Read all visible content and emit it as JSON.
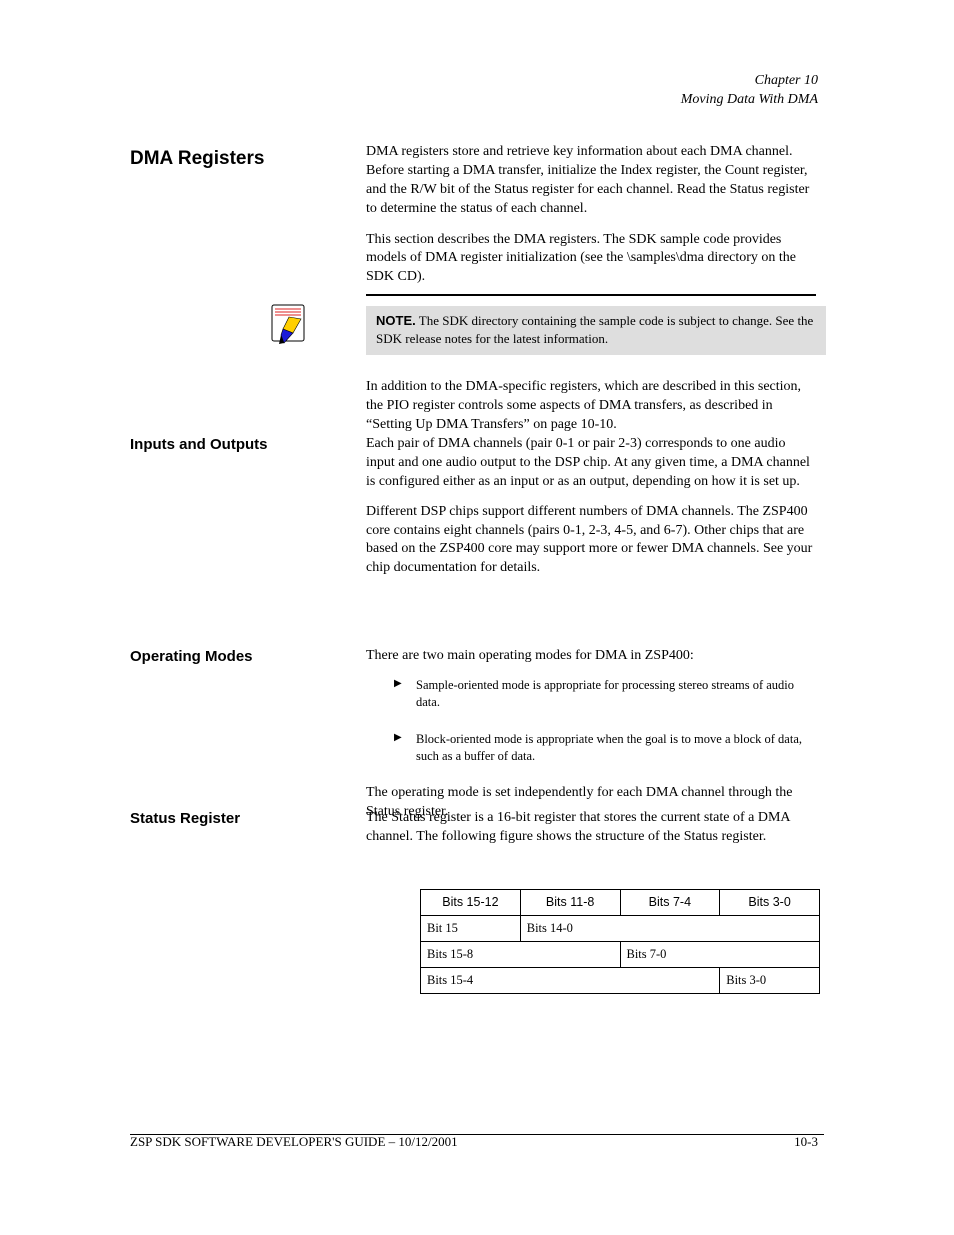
{
  "running_header": {
    "line1": "Chapter 10",
    "line2": "Moving Data With DMA"
  },
  "section_title": "DMA Registers",
  "intro": {
    "p1": "DMA registers store and retrieve key information about each DMA channel. Before starting a DMA transfer, initialize the Index register, the Count register, and the R/W bit of the Status register for each channel. Read the Status register to determine the status of each channel.",
    "p2": "This section describes the DMA registers. The SDK sample code provides models of DMA register initialization (see the \\samples\\dma directory on the SDK CD)."
  },
  "note": {
    "label": "NOTE.",
    "text": " The SDK directory containing the sample code is subject to change. See the SDK release notes for the latest information."
  },
  "after_note": "In addition to the DMA-specific registers, which are described in this section, the PIO register controls some aspects of DMA transfers, as described in “Setting Up DMA Transfers” on page 10-10.",
  "inouts": {
    "title": "Inputs and Outputs",
    "p1": "Each pair of DMA channels (pair 0-1 or pair 2-3) corresponds to one audio input and one audio output to the DSP chip. At any given time, a DMA channel is configured either as an input or as an output, depending on how it is set up.",
    "p2": "Different DSP chips support different numbers of DMA channels. The ZSP400 core contains eight channels (pairs 0-1, 2-3, 4-5, and 6-7). Other chips that are based on the ZSP400 core may support more or fewer DMA channels. See your chip documentation for details."
  },
  "ops": {
    "title": "Operating Modes",
    "p": "There are two main operating modes for DMA in ZSP400:",
    "bullet1": "Sample-oriented mode is appropriate for processing stereo streams of audio data.",
    "bullet2": "Block-oriented mode is appropriate when the goal is to move a block of data, such as a buffer of data.",
    "trail": "The operating mode is set independently for each DMA channel through the Status register."
  },
  "status": {
    "title": "Status Register",
    "intro": "The Status register is a 16-bit register that stores the current state of a DMA channel. The following figure shows the structure of the Status register."
  },
  "table": {
    "r0": [
      "Bits 15-12",
      "Bits 11-8",
      "Bits 7-4",
      "Bits 3-0"
    ],
    "r1_left": "Bit 15",
    "r1_right": "Bits 14-0",
    "r2_left": "Bits 15-8",
    "r2_right": "Bits 7-0",
    "r3_left": "Bits 15-4",
    "r3_right": "Bits 3-0"
  },
  "footer": {
    "left": "ZSP SDK SOFTWARE DEVELOPER'S GUIDE – 10/12/2001",
    "right": "10-3"
  }
}
